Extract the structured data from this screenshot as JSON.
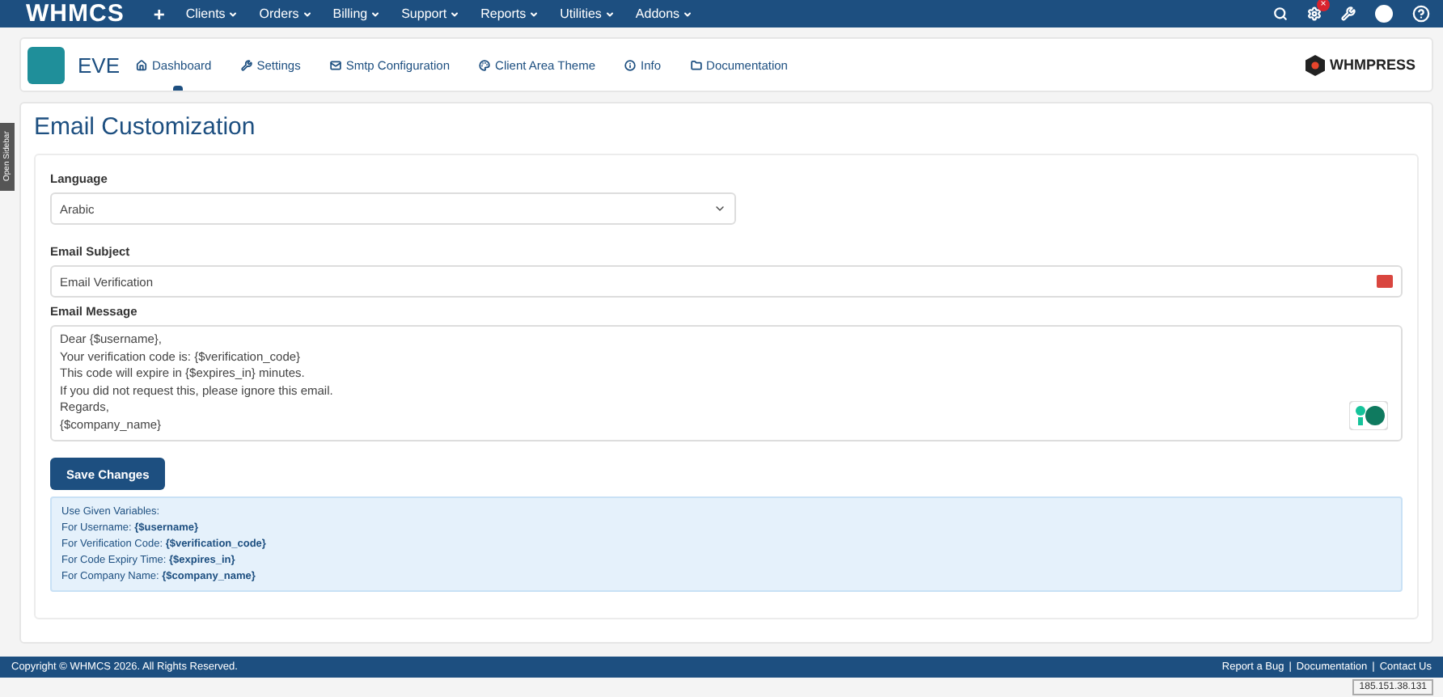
{
  "topbar": {
    "logo": "WHMCS",
    "add": "+",
    "menu": [
      {
        "label": "Clients"
      },
      {
        "label": "Orders"
      },
      {
        "label": "Billing"
      },
      {
        "label": "Support"
      },
      {
        "label": "Reports"
      },
      {
        "label": "Utilities"
      },
      {
        "label": "Addons"
      }
    ],
    "notification_badge": "×"
  },
  "module": {
    "name": "EVE",
    "tabs": [
      {
        "label": "Dashboard",
        "selected": true
      },
      {
        "label": "Settings",
        "selected": false
      },
      {
        "label": "Smtp Configuration",
        "selected": false
      },
      {
        "label": "Client Area Theme",
        "selected": false
      },
      {
        "label": "Info",
        "selected": false
      },
      {
        "label": "Documentation",
        "selected": false
      }
    ],
    "brand": "WHMPRESS"
  },
  "sidebar_toggle": "Open Sidebar",
  "page_title": "Email Customization",
  "form": {
    "language_label": "Language",
    "language_value": "Arabic",
    "subject_label": "Email Subject",
    "subject_value": "Email Verification",
    "message_label": "Email Message",
    "message_value": "Dear {$username},\nYour verification code is: {$verification_code}\nThis code will expire in {$expires_in} minutes.\nIf you did not request this, please ignore this email.\nRegards,\n{$company_name}",
    "save_button": "Save Changes"
  },
  "variables": {
    "heading": "Use Given Variables:",
    "lines": [
      "For Username: **{$username}**",
      "For Verification Code: **{$verification_code}**",
      "For Code Expiry Time: **{$expires_in}**",
      "For Company Name: **{$company_name}**"
    ]
  },
  "footer": {
    "copyright": "Copyright © WHMCS 2026. All Rights Reserved.",
    "links": [
      "Report a Bug",
      "Documentation",
      "Contact Us"
    ],
    "separator": "|"
  },
  "ip_address": "185.151.38.131"
}
